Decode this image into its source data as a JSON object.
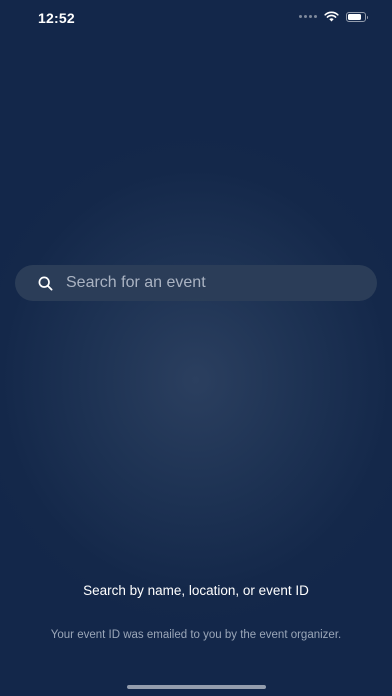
{
  "status_bar": {
    "time": "12:52",
    "battery_level": 0.8,
    "icons": [
      "signal-dots-icon",
      "wifi-icon",
      "battery-icon"
    ]
  },
  "search": {
    "placeholder": "Search for an event",
    "value": ""
  },
  "hint": {
    "title": "Search by name, location, or event ID",
    "subtitle": "Your event ID was emailed to you by the event organizer."
  },
  "colors": {
    "background": "#14284a",
    "search_bar": "#2c3e58",
    "text_primary": "#ffffff",
    "text_secondary": "#9aa6b8"
  }
}
